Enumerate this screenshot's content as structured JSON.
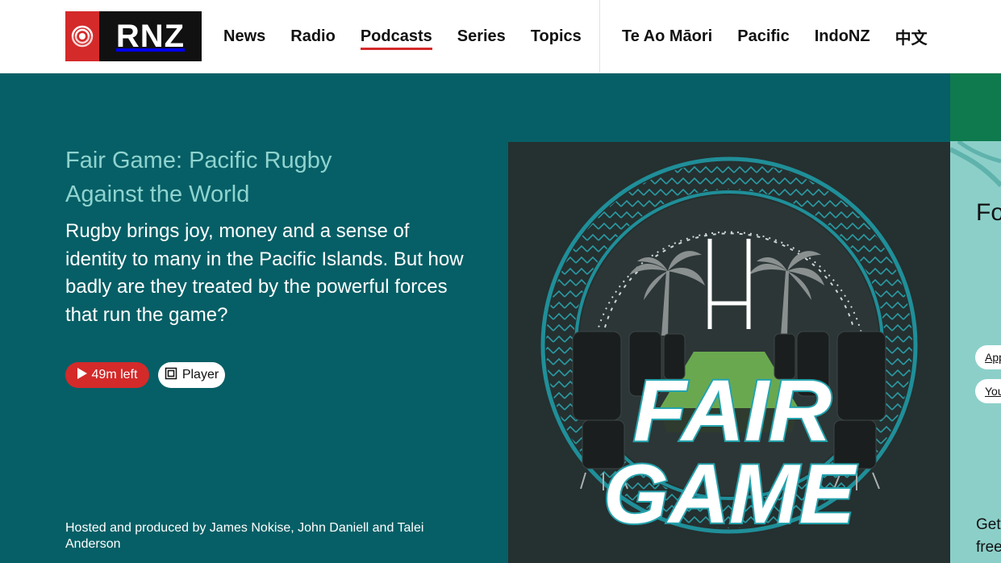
{
  "header": {
    "logo_text": "RNZ",
    "nav_main": [
      "News",
      "Radio",
      "Podcasts",
      "Series",
      "Topics"
    ],
    "nav_active": "Podcasts",
    "nav_secondary": [
      "Te Ao Māori",
      "Pacific",
      "IndoNZ",
      "中文"
    ]
  },
  "hero": {
    "title": "Fair Game: Pacific Rugby Against the World",
    "description": "Rugby brings joy, money and a sense of identity to many in the Pacific Islands. But how badly are they treated by the powerful forces that run the game?",
    "play_label": "49m left",
    "player_label": "Player",
    "host_text": "Hosted and produced by James Nokise, John Daniell and Talei Anderson"
  },
  "artwork": {
    "word_1": "FAIR",
    "word_2": "GAME"
  },
  "side_panel": {
    "heading_partial": "Fo",
    "pill_1": "App",
    "pill_2": "You",
    "line_1": "Get",
    "line_2": "free"
  },
  "colors": {
    "brand_red": "#d42a2a",
    "hero_bg": "#065f66",
    "title_teal": "#8fd3cf",
    "artwork_bg": "#253030",
    "side_panel": "#8ccfc9"
  },
  "icons": [
    "radio-waves-icon",
    "play-icon",
    "player-popout-icon",
    "palm-tree-icon",
    "goal-post-icon"
  ]
}
